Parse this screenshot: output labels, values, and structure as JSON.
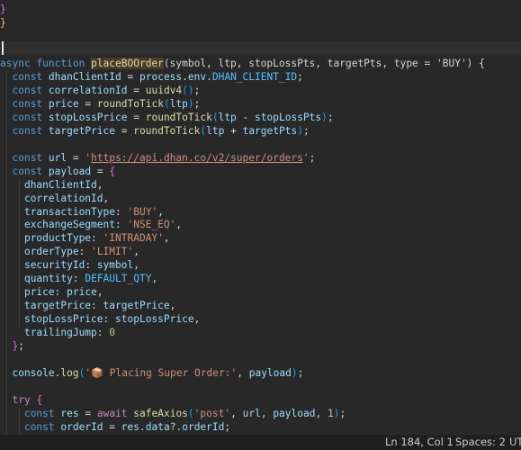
{
  "editor": {
    "top_text": {
      "close_paren": "}",
      "close_brace": "}"
    },
    "function_signature": {
      "async": "async",
      "function": "function",
      "name": "placeBOOrder",
      "params": "(symbol, ltp, stopLossPts, targetPts, type = 'BUY') {"
    },
    "lines": [
      {
        "text": "  const dhanClientId = process.env.DHAN_CLIENT_ID;"
      },
      {
        "text": "  const correlationId = uuidv4();"
      },
      {
        "text": "  const price = roundToTick(ltp);"
      },
      {
        "text": "  const stopLossPrice = roundToTick(ltp - stopLossPts);"
      },
      {
        "text": "  const targetPrice = roundToTick(ltp + targetPts);"
      },
      {
        "text": ""
      },
      {
        "text": "  const url = 'https://api.dhan.co/v2/super/orders';"
      },
      {
        "text": "  const payload = {"
      },
      {
        "text": "    dhanClientId,"
      },
      {
        "text": "    correlationId,"
      },
      {
        "text": "    transactionType: 'BUY',"
      },
      {
        "text": "    exchangeSegment: 'NSE_EQ',"
      },
      {
        "text": "    productType: 'INTRADAY',"
      },
      {
        "text": "    orderType: 'LIMIT',"
      },
      {
        "text": "    securityId: symbol,"
      },
      {
        "text": "    quantity: DEFAULT_QTY,"
      },
      {
        "text": "    price: price,"
      },
      {
        "text": "    targetPrice: targetPrice,"
      },
      {
        "text": "    stopLossPrice: stopLossPrice,"
      },
      {
        "text": "    trailingJump: 0"
      },
      {
        "text": "  };"
      },
      {
        "text": ""
      },
      {
        "text": "  console.log('📦 Placing Super Order:', payload);"
      },
      {
        "text": ""
      },
      {
        "text": "  try {"
      },
      {
        "text": "    const res = await safeAxios('post', url, payload, 1);"
      },
      {
        "text": "    const orderId = res.data?.orderId;"
      }
    ]
  },
  "statusbar": {
    "position": "Ln 184, Col 1",
    "spaces": "Spaces: 2",
    "encoding": "UT"
  }
}
